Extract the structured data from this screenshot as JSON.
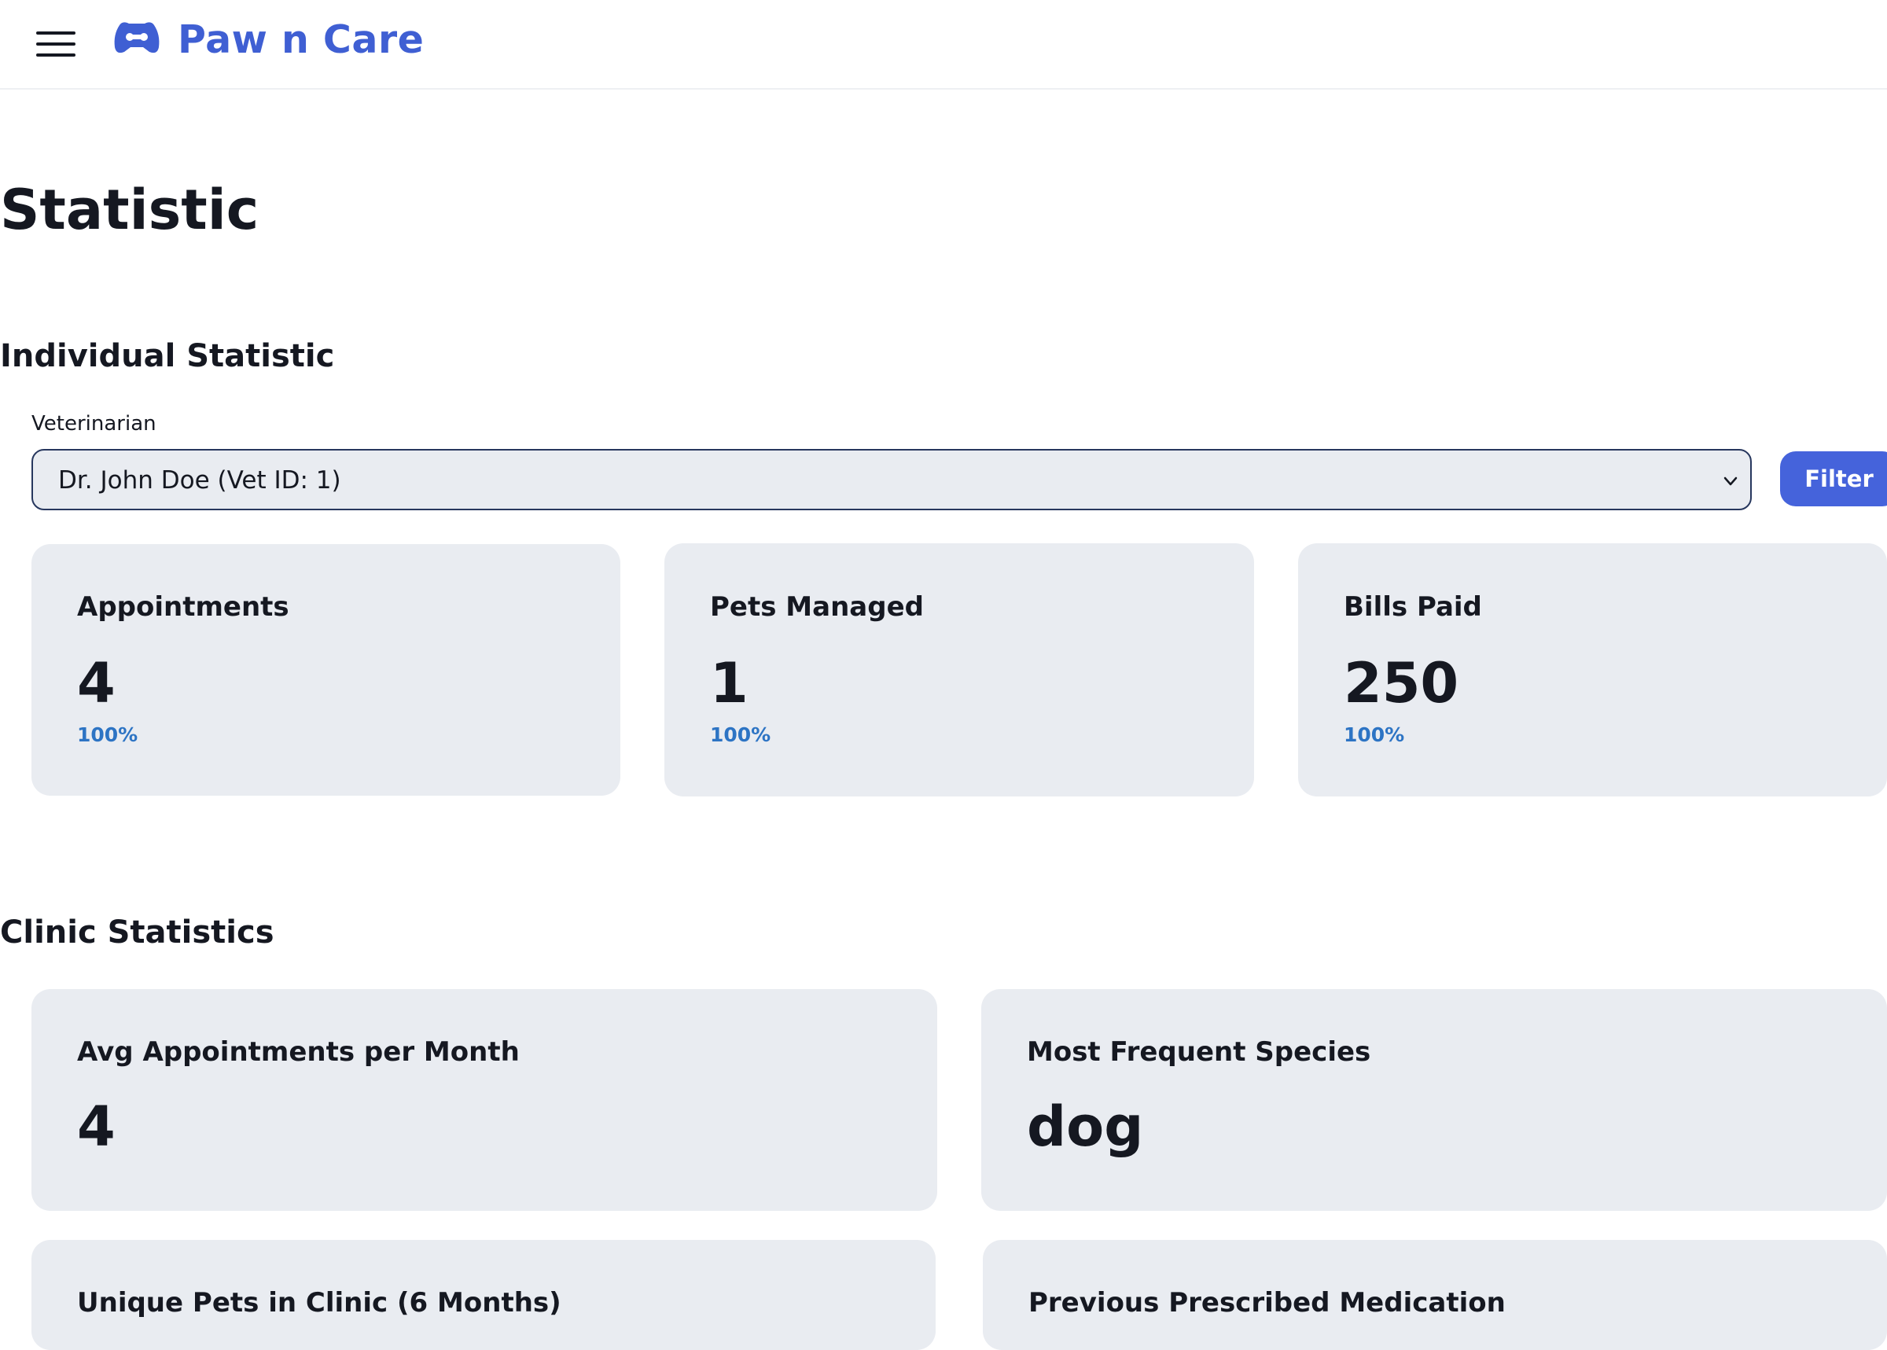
{
  "header": {
    "brand": "Paw n Care",
    "menu_icon": "hamburger-menu-icon",
    "logo_icon": "paw-logo-icon",
    "brand_color": "#3f5fd3"
  },
  "page": {
    "title": "Statistic"
  },
  "individual": {
    "section_title": "Individual Statistic",
    "vet_label": "Veterinarian",
    "vet_selected": "Dr. John Doe (Vet ID: 1)",
    "filter_label": "Filter",
    "cards": [
      {
        "title": "Appointments",
        "value": "4",
        "pct": "100%"
      },
      {
        "title": "Pets Managed",
        "value": "1",
        "pct": "100%"
      },
      {
        "title": "Bills Paid",
        "value": "250",
        "pct": "100%"
      }
    ]
  },
  "clinic": {
    "section_title": "Clinic Statistics",
    "cards": [
      {
        "title": "Avg Appointments per Month",
        "value": "4"
      },
      {
        "title": "Most Frequent Species",
        "value": "dog"
      }
    ],
    "partial_cards": [
      {
        "title": "Unique Pets in Clinic (6 Months)"
      },
      {
        "title": "Previous Prescribed Medication"
      }
    ]
  },
  "colors": {
    "accent": "#4563db",
    "card_bg": "#e9ecf1",
    "percent_text": "#2d74c4",
    "text_dark": "#151821"
  }
}
